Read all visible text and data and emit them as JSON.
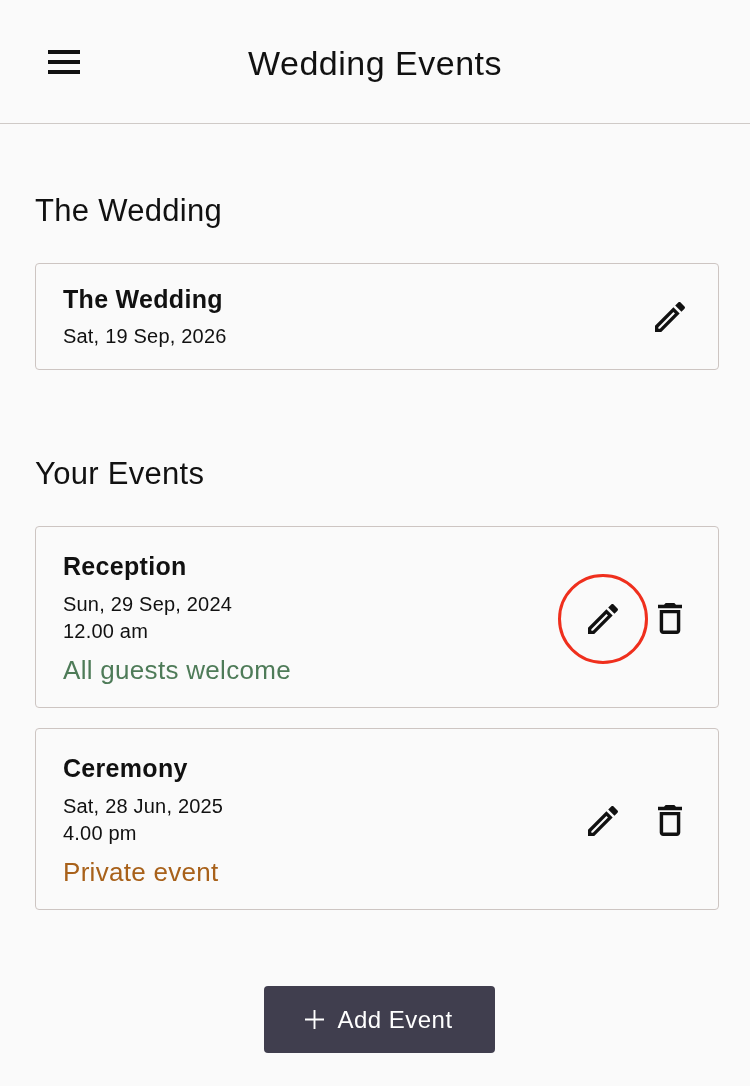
{
  "app_bar": {
    "title": "Wedding Events"
  },
  "wedding": {
    "heading": "The Wedding",
    "card": {
      "name": "The Wedding",
      "date": "Sat, 19 Sep, 2026"
    }
  },
  "events": {
    "heading": "Your Events",
    "items": [
      {
        "name": "Reception",
        "date": "Sun, 29 Sep, 2024",
        "time": "12.00 am",
        "access": "All guests welcome",
        "color": "#4e7b58",
        "highlighted": true
      },
      {
        "name": "Ceremony",
        "date": "Sat, 28 Jun, 2025",
        "time": "4.00 pm",
        "access": "Private event",
        "color": "#a8611a",
        "highlighted": false
      }
    ]
  },
  "add_button": {
    "label": "Add Event"
  }
}
